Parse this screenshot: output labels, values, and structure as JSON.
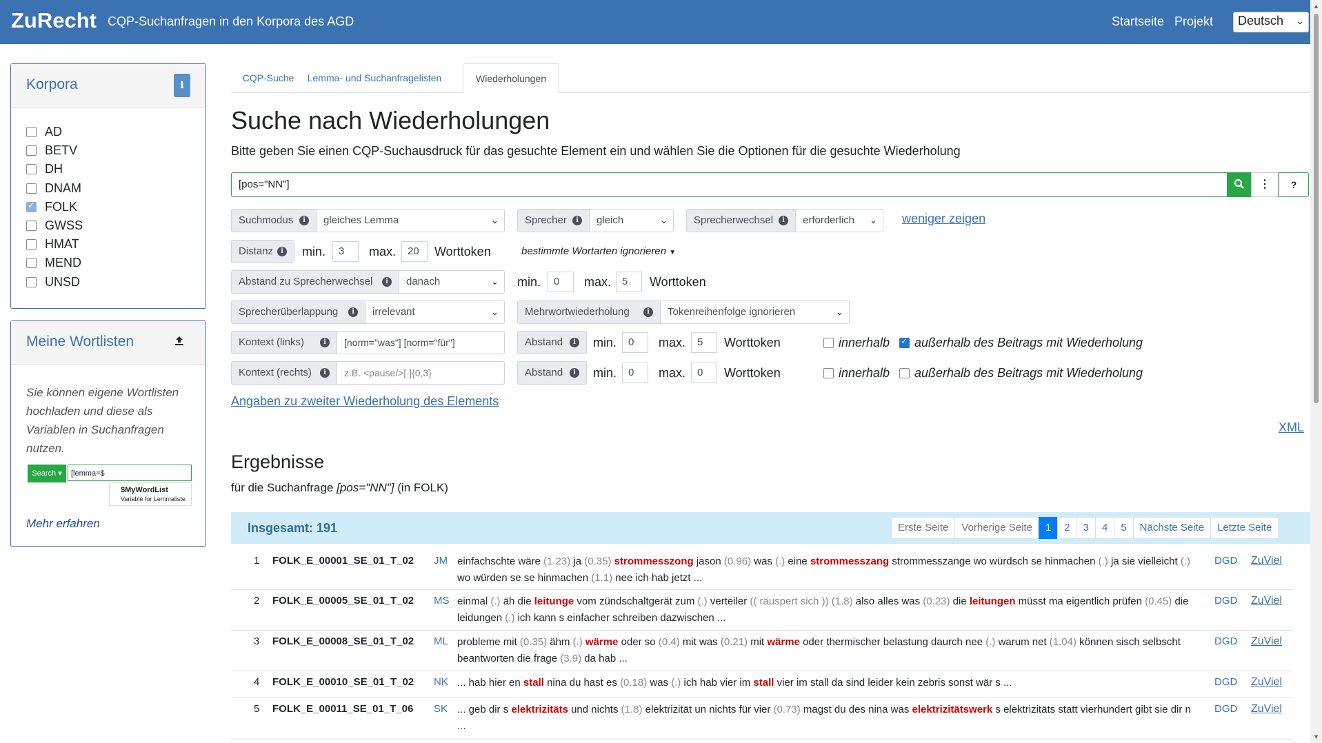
{
  "nav": {
    "brand": "ZuRecht",
    "subtitle": "CQP-Suchanfragen in den Korpora des AGD",
    "links": [
      "Startseite",
      "Projekt"
    ],
    "language": "Deutsch"
  },
  "korpora": {
    "title": "Korpora",
    "items": [
      {
        "label": "AD",
        "checked": false
      },
      {
        "label": "BETV",
        "checked": false
      },
      {
        "label": "DH",
        "checked": false
      },
      {
        "label": "DNAM",
        "checked": false
      },
      {
        "label": "FOLK",
        "checked": true
      },
      {
        "label": "GWSS",
        "checked": false
      },
      {
        "label": "HMAT",
        "checked": false
      },
      {
        "label": "MEND",
        "checked": false
      },
      {
        "label": "UNSD",
        "checked": false
      }
    ]
  },
  "wordlists": {
    "title": "Meine Wortlisten",
    "text": "Sie können eigene Wortlisten hochladen und diese als Variablen in Suchanfragen nutzen.",
    "example_search": "Search ▾",
    "example_input": "[lemma=$",
    "example_var": "$MyWordList",
    "example_var_desc": "Variable for Lemmaliste",
    "more": "Mehr erfahren"
  },
  "tabs": [
    "CQP-Suche",
    "Lemma- und Suchanfragelisten",
    "Wiederholungen"
  ],
  "main": {
    "heading": "Suche nach Wiederholungen",
    "intro": "Bitte geben Sie einen CQP-Suchausdruck für das gesuchte Element ein und wählen Sie die Optionen für die gesuchte Wiederholung",
    "query": "[pos=\"NN\"]",
    "help": "?"
  },
  "options": {
    "suchmodus_label": "Suchmodus",
    "suchmodus_value": "gleiches Lemma",
    "sprecher_label": "Sprecher",
    "sprecher_value": "gleich",
    "sprecherwechsel_label": "Sprecherwechsel",
    "sprecherwechsel_value": "erforderlich",
    "weniger": "weniger zeigen",
    "distanz_label": "Distanz",
    "min": "min.",
    "max": "max.",
    "distanz_min": "3",
    "distanz_max": "20",
    "worttoken": "Worttoken",
    "wortarten": "bestimmte Wortarten ignorieren",
    "abstand_sw_label": "Abstand zu Sprecherwechsel",
    "abstand_sw_value": "danach",
    "abstand_sw_min": "0",
    "abstand_sw_max": "5",
    "ueberlappung_label": "Sprecherüberlappung",
    "ueberlappung_value": "irrelevant",
    "mehrwort_label": "Mehrwortwiederholung",
    "mehrwort_value": "Tokenreihenfolge ignorieren",
    "ctx_links_label": "Kontext (links)",
    "ctx_links_value": "[norm=\"was\"] [norm=\"für\"]",
    "ctx_rechts_label": "Kontext (rechts)",
    "ctx_rechts_placeholder": "z.B. <pause/>[ ]{0,3}",
    "abstand_label": "Abstand",
    "abstand1_min": "0",
    "abstand1_max": "5",
    "abstand2_min": "0",
    "abstand2_max": "0",
    "innerhalb": "innerhalb",
    "ausserhalb": "außerhalb des Beitrags mit Wiederholung",
    "zweite": "Angaben zu zweiter Wiederholung des Elements",
    "xml": "XML"
  },
  "results": {
    "heading": "Ergebnisse",
    "for_prefix": "für die Suchanfrage",
    "for_query": "[pos=\"NN\"]",
    "for_suffix": "(in FOLK)",
    "total": "Insgesamt: 191",
    "pager": {
      "first": "Erste Seite",
      "prev": "Vorherige Seite",
      "pages": [
        "1",
        "2",
        "3",
        "4",
        "5"
      ],
      "next": "Nächste Seite",
      "last": "Letzte Seite"
    },
    "dgd": "DGD",
    "zuviel": "ZuViel",
    "rows": [
      {
        "num": "1",
        "id": "FOLK_E_00001_SE_01_T_02",
        "speaker": "JM",
        "text": [
          [
            "t",
            "einfachschte wäre "
          ],
          [
            "p",
            "(1.23)"
          ],
          [
            "t",
            " ja "
          ],
          [
            "p",
            "(0.35)"
          ],
          [
            "t",
            " "
          ],
          [
            "h",
            "strommesszong"
          ],
          [
            "t",
            " jason "
          ],
          [
            "p",
            "(0.96)"
          ],
          [
            "t",
            " was "
          ],
          [
            "p",
            "(.)"
          ],
          [
            "t",
            " eine "
          ],
          [
            "h",
            "strommesszang"
          ],
          [
            "t",
            " strommesszange wo würdsch se hinmachen "
          ],
          [
            "p",
            "(.)"
          ],
          [
            "t",
            " ja sie vielleicht "
          ],
          [
            "p",
            "(.)"
          ],
          [
            "t",
            " wo würden se se hinmachen "
          ],
          [
            "p",
            "(1.1)"
          ],
          [
            "t",
            " nee ich hab jetzt ..."
          ]
        ]
      },
      {
        "num": "2",
        "id": "FOLK_E_00005_SE_01_T_02",
        "speaker": "MS",
        "text": [
          [
            "t",
            "einmal "
          ],
          [
            "p",
            "(.)"
          ],
          [
            "t",
            " äh die "
          ],
          [
            "h",
            "leitunge"
          ],
          [
            "t",
            " vom zündschaltgerät zum "
          ],
          [
            "p",
            "(.)"
          ],
          [
            "t",
            " verteiler "
          ],
          [
            "p",
            "(( räuspert sich ))"
          ],
          [
            "t",
            " "
          ],
          [
            "p",
            "(1.8)"
          ],
          [
            "t",
            " also alles was "
          ],
          [
            "p",
            "(0.23)"
          ],
          [
            "t",
            " die "
          ],
          [
            "h",
            "leitungen"
          ],
          [
            "t",
            " müsst ma eigentlich prüfen "
          ],
          [
            "p",
            "(0.45)"
          ],
          [
            "t",
            " die leidungen "
          ],
          [
            "p",
            "(.)"
          ],
          [
            "t",
            " ich kann s einfacher schreiben dazwischen ..."
          ]
        ]
      },
      {
        "num": "3",
        "id": "FOLK_E_00008_SE_01_T_02",
        "speaker": "ML",
        "text": [
          [
            "t",
            "probleme mit "
          ],
          [
            "p",
            "(0.35)"
          ],
          [
            "t",
            " ähm "
          ],
          [
            "p",
            "(.)"
          ],
          [
            "t",
            " "
          ],
          [
            "h",
            "wärme"
          ],
          [
            "t",
            " oder so "
          ],
          [
            "p",
            "(0.4)"
          ],
          [
            "t",
            " mit was "
          ],
          [
            "p",
            "(0.21)"
          ],
          [
            "t",
            " mit "
          ],
          [
            "h",
            "wärme"
          ],
          [
            "t",
            " oder thermischer belastung daurch nee "
          ],
          [
            "p",
            "(.)"
          ],
          [
            "t",
            " warum net "
          ],
          [
            "p",
            "(1.04)"
          ],
          [
            "t",
            " können sisch selbscht beantworten die frage "
          ],
          [
            "p",
            "(3.9)"
          ],
          [
            "t",
            " da hab ..."
          ]
        ]
      },
      {
        "num": "4",
        "id": "FOLK_E_00010_SE_01_T_02",
        "speaker": "NK",
        "text": [
          [
            "t",
            "... hab hier en "
          ],
          [
            "h",
            "stall"
          ],
          [
            "t",
            " nina du hast es "
          ],
          [
            "p",
            "(0.18)"
          ],
          [
            "t",
            " was "
          ],
          [
            "p",
            "(.)"
          ],
          [
            "t",
            " ich hab vier im "
          ],
          [
            "h",
            "stall"
          ],
          [
            "t",
            " vier im stall da sind leider kein zebris sonst wär s ..."
          ]
        ]
      },
      {
        "num": "5",
        "id": "FOLK_E_00011_SE_01_T_06",
        "speaker": "SK",
        "text": [
          [
            "t",
            "... geb dir s "
          ],
          [
            "h",
            "elektrizitäts"
          ],
          [
            "t",
            " und nichts "
          ],
          [
            "p",
            "(1.8)"
          ],
          [
            "t",
            " elektrizität un nichts für vier "
          ],
          [
            "p",
            "(0.73)"
          ],
          [
            "t",
            " magst du des nina was "
          ],
          [
            "h",
            "elektrizitätswerk"
          ],
          [
            "t",
            " s elektrizitäts statt vierhundert gibt sie dir n ..."
          ]
        ]
      }
    ]
  },
  "icons": {
    "info": "info-icon",
    "search": "search-icon",
    "more": "more-vertical-icon",
    "upload": "upload-icon"
  },
  "colors": {
    "navbar": "#3a72b2",
    "search_green": "#28a745",
    "highlight": "#d00000",
    "results_bar": "#d1ecf9"
  }
}
